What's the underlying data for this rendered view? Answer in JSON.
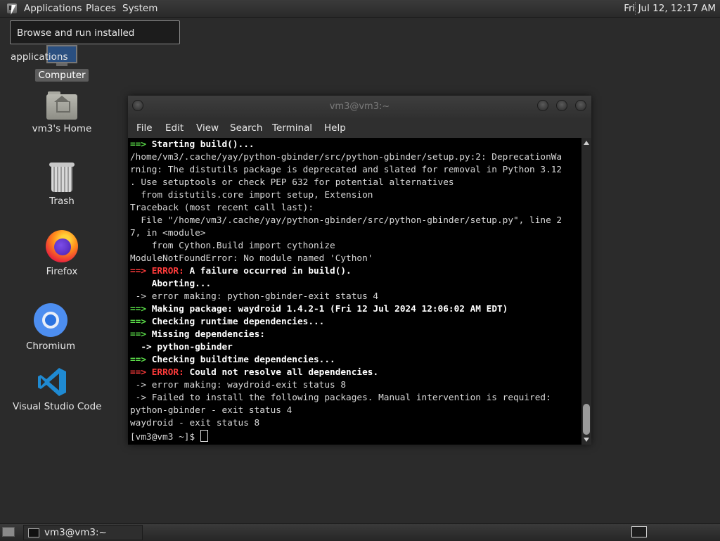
{
  "top_panel": {
    "menus": [
      "Applications",
      "Places",
      "System"
    ],
    "clock": "Fri Jul 12, 12:17 AM"
  },
  "tooltip": {
    "text": "Browse and run installed applications"
  },
  "desktop_icons": [
    {
      "label": "Computer",
      "icon": "computer-icon"
    },
    {
      "label": "vm3's Home",
      "icon": "home-folder-icon"
    },
    {
      "label": "Trash",
      "icon": "trash-icon"
    },
    {
      "label": "Firefox",
      "icon": "firefox-icon"
    },
    {
      "label": "Chromium",
      "icon": "chromium-icon"
    },
    {
      "label": "Visual Studio Code",
      "icon": "vscode-icon"
    }
  ],
  "terminal": {
    "title": "vm3@vm3:~",
    "menus": [
      "File",
      "Edit",
      "View",
      "Search",
      "Terminal",
      "Help"
    ],
    "lines": [
      [
        {
          "t": "==> ",
          "c": "g"
        },
        {
          "t": "Starting build()...",
          "c": "b"
        }
      ],
      [
        {
          "t": "/home/vm3/.cache/yay/python-gbinder/src/python-gbinder/setup.py:2: DeprecationWa"
        }
      ],
      [
        {
          "t": "rning: The distutils package is deprecated and slated for removal in Python 3.12"
        }
      ],
      [
        {
          "t": ". Use setuptools or check PEP 632 for potential alternatives"
        }
      ],
      [
        {
          "t": "  from distutils.core import setup, Extension"
        }
      ],
      [
        {
          "t": "Traceback (most recent call last):"
        }
      ],
      [
        {
          "t": "  File \"/home/vm3/.cache/yay/python-gbinder/src/python-gbinder/setup.py\", line 2"
        }
      ],
      [
        {
          "t": "7, in <module>"
        }
      ],
      [
        {
          "t": "    from Cython.Build import cythonize"
        }
      ],
      [
        {
          "t": "ModuleNotFoundError: No module named 'Cython'"
        }
      ],
      [
        {
          "t": "==> ",
          "c": "r"
        },
        {
          "t": "ERROR: ",
          "c": "r"
        },
        {
          "t": "A failure occurred in build().",
          "c": "b"
        }
      ],
      [
        {
          "t": "    Aborting...",
          "c": "b"
        }
      ],
      [
        {
          "t": " -> error making: python-gbinder-exit status 4"
        }
      ],
      [
        {
          "t": "==> ",
          "c": "g"
        },
        {
          "t": "Making package: waydroid 1.4.2-1 (Fri 12 Jul 2024 12:06:02 AM EDT)",
          "c": "b"
        }
      ],
      [
        {
          "t": "==> ",
          "c": "g"
        },
        {
          "t": "Checking runtime dependencies...",
          "c": "b"
        }
      ],
      [
        {
          "t": "==> ",
          "c": "g"
        },
        {
          "t": "Missing dependencies:",
          "c": "b"
        }
      ],
      [
        {
          "t": "  -> ",
          "c": "b"
        },
        {
          "t": "python-gbinder",
          "c": "b"
        }
      ],
      [
        {
          "t": "==> ",
          "c": "g"
        },
        {
          "t": "Checking buildtime dependencies...",
          "c": "b"
        }
      ],
      [
        {
          "t": "==> ",
          "c": "r"
        },
        {
          "t": "ERROR: ",
          "c": "r"
        },
        {
          "t": "Could not resolve all dependencies.",
          "c": "b"
        }
      ],
      [
        {
          "t": " -> error making: waydroid-exit status 8"
        }
      ],
      [
        {
          "t": " -> Failed to install the following packages. Manual intervention is required:"
        }
      ],
      [
        {
          "t": "python-gbinder - exit status 4"
        }
      ],
      [
        {
          "t": "waydroid - exit status 8"
        }
      ]
    ],
    "prompt": "[vm3@vm3 ~]$ "
  },
  "bottom_panel": {
    "task_label": "vm3@vm3:~"
  },
  "colors": {
    "prompt_green": "#5ce04a",
    "error_red": "#ff3b3b"
  }
}
